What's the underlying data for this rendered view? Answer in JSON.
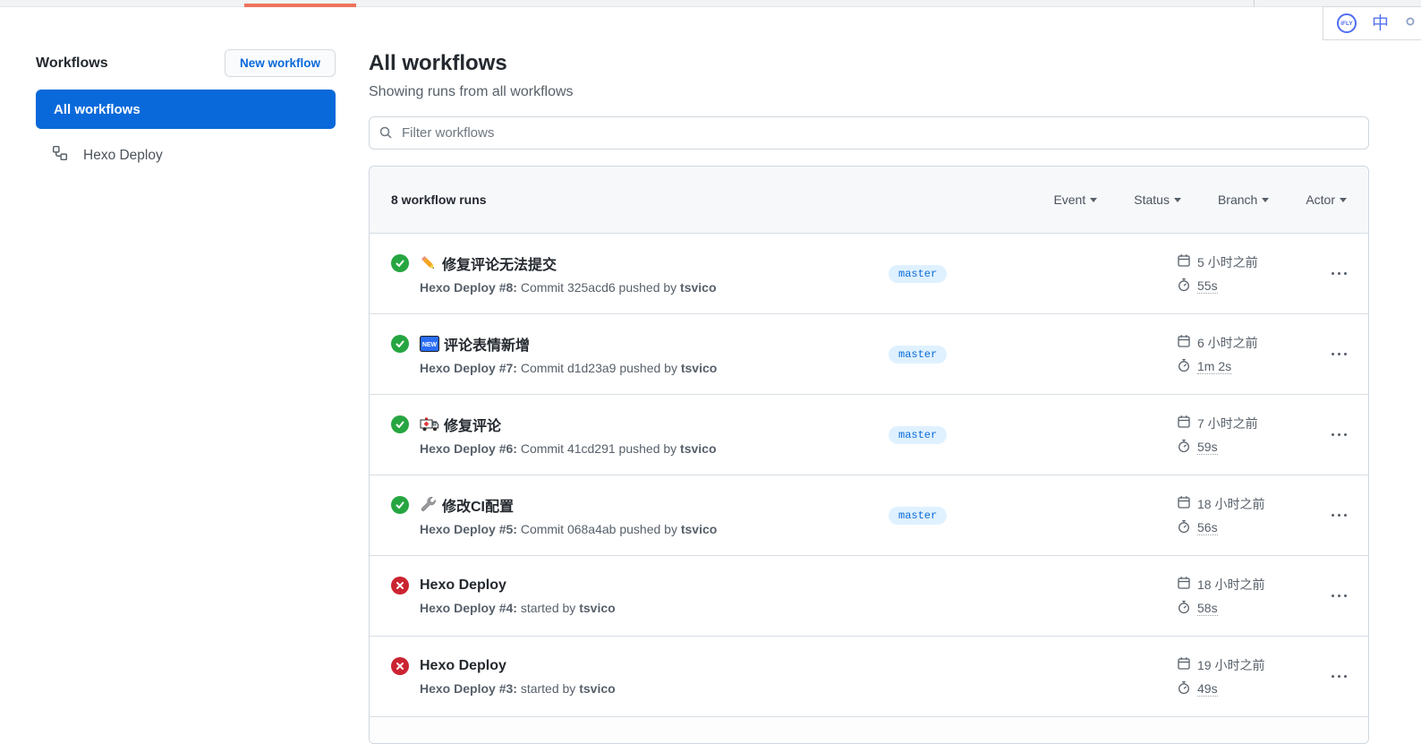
{
  "browser": {
    "progress_color": "#ed735c"
  },
  "translator_widget": {
    "logo_text": "iFLY",
    "language_label": "中"
  },
  "sidebar": {
    "title": "Workflows",
    "new_workflow_button": "New workflow",
    "selected_item": "All workflows",
    "workflows": [
      {
        "label": "Hexo Deploy"
      }
    ]
  },
  "main": {
    "title": "All workflows",
    "subtitle": "Showing runs from all workflows",
    "filter_placeholder": "Filter workflows",
    "new_badge_text": "NEW",
    "runs_header": {
      "count_label": "8 workflow runs",
      "filters": [
        {
          "label": "Event"
        },
        {
          "label": "Status"
        },
        {
          "label": "Branch"
        },
        {
          "label": "Actor"
        }
      ]
    },
    "runs": [
      {
        "status": "success",
        "icon": "pencil",
        "title": "修复评论无法提交",
        "run_ref": "Hexo Deploy #8:",
        "description": "Commit 325acd6 pushed by",
        "actor": "tsvico",
        "branch": "master",
        "time": "5 小时之前",
        "duration": "55s"
      },
      {
        "status": "success",
        "icon": "new-badge",
        "title": "评论表情新增",
        "run_ref": "Hexo Deploy #7:",
        "description": "Commit d1d23a9 pushed by",
        "actor": "tsvico",
        "branch": "master",
        "time": "6 小时之前",
        "duration": "1m 2s"
      },
      {
        "status": "success",
        "icon": "ambulance",
        "title": "修复评论",
        "run_ref": "Hexo Deploy #6:",
        "description": "Commit 41cd291 pushed by",
        "actor": "tsvico",
        "branch": "master",
        "time": "7 小时之前",
        "duration": "59s"
      },
      {
        "status": "success",
        "icon": "wrench",
        "title": "修改CI配置",
        "run_ref": "Hexo Deploy #5:",
        "description": "Commit 068a4ab pushed by",
        "actor": "tsvico",
        "branch": "master",
        "time": "18 小时之前",
        "duration": "56s"
      },
      {
        "status": "failure",
        "icon": "",
        "title": "Hexo Deploy",
        "run_ref": "Hexo Deploy #4:",
        "description": "started by",
        "actor": "tsvico",
        "branch": "",
        "time": "18 小时之前",
        "duration": "58s"
      },
      {
        "status": "failure",
        "icon": "",
        "title": "Hexo Deploy",
        "run_ref": "Hexo Deploy #3:",
        "description": "started by",
        "actor": "tsvico",
        "branch": "",
        "time": "19 小时之前",
        "duration": "49s"
      }
    ]
  }
}
